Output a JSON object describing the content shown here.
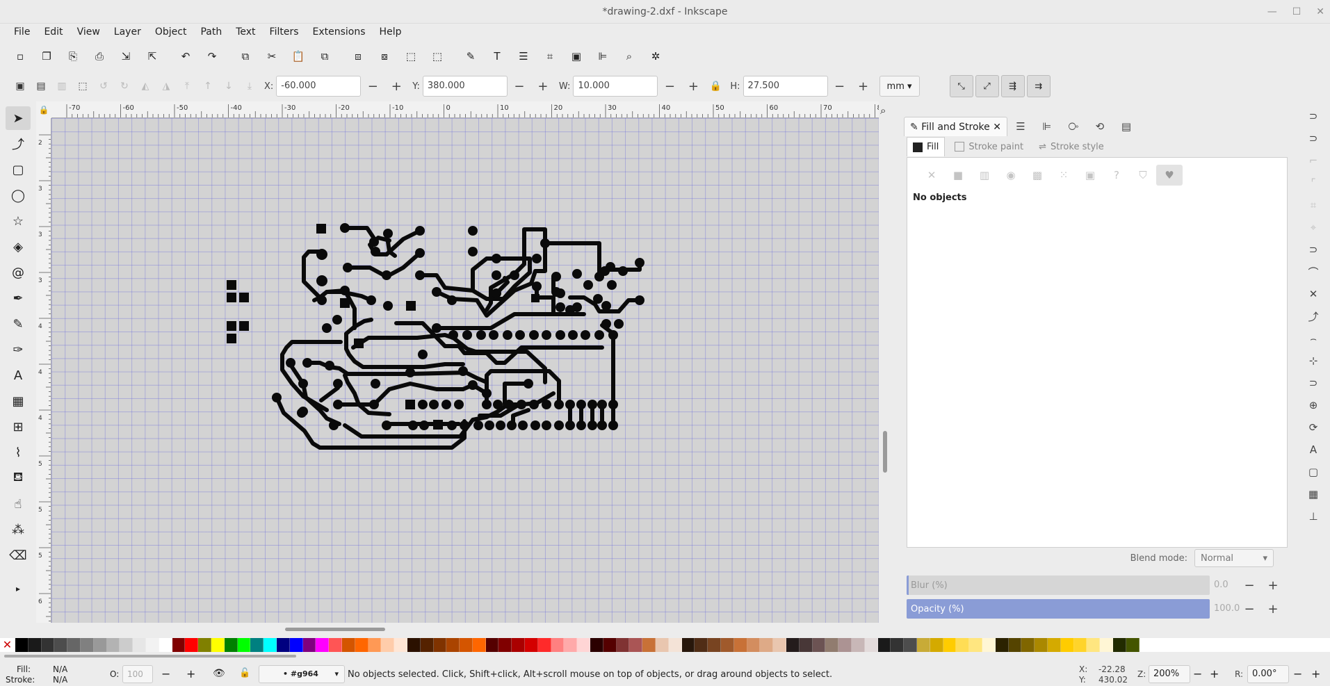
{
  "window": {
    "title": "*drawing-2.dxf - Inkscape",
    "controls": [
      "—",
      "☐",
      "✕"
    ]
  },
  "menu": [
    "File",
    "Edit",
    "View",
    "Layer",
    "Object",
    "Path",
    "Text",
    "Filters",
    "Extensions",
    "Help"
  ],
  "commands": [
    {
      "name": "new-document-icon",
      "g": "▫"
    },
    {
      "name": "open-document-icon",
      "g": "❐"
    },
    {
      "name": "save-document-icon",
      "g": "⎘"
    },
    {
      "name": "print-icon",
      "g": "⎙"
    },
    {
      "name": "import-icon",
      "g": "⇲"
    },
    {
      "name": "export-icon",
      "g": "⇱"
    },
    {
      "name": "undo-icon",
      "g": "↶"
    },
    {
      "name": "redo-icon",
      "g": "↷"
    },
    {
      "name": "copy-icon",
      "g": "⧉"
    },
    {
      "name": "cut-icon",
      "g": "✂"
    },
    {
      "name": "paste-icon",
      "g": "📋"
    },
    {
      "name": "duplicate-icon",
      "g": "⧉"
    },
    {
      "name": "clone-icon",
      "g": "⧈"
    },
    {
      "name": "unlink-clone-icon",
      "g": "⧇"
    },
    {
      "name": "group-icon",
      "g": "⬚"
    },
    {
      "name": "ungroup-icon",
      "g": "⬚"
    },
    {
      "name": "fill-stroke-dialog-icon",
      "g": "✎"
    },
    {
      "name": "text-font-dialog-icon",
      "g": "T"
    },
    {
      "name": "layers-dialog-icon",
      "g": "☰"
    },
    {
      "name": "xml-editor-icon",
      "g": "⌗"
    },
    {
      "name": "document-properties-icon",
      "g": "▣"
    },
    {
      "name": "align-dialog-icon",
      "g": "⊫"
    },
    {
      "name": "find-icon",
      "g": "⌕"
    },
    {
      "name": "preferences-icon",
      "g": "✲"
    }
  ],
  "controls": {
    "x": {
      "label": "X:",
      "value": "-60.000"
    },
    "y": {
      "label": "Y:",
      "value": "380.000"
    },
    "w": {
      "label": "W:",
      "value": "10.000"
    },
    "h": {
      "label": "H:",
      "value": "27.500"
    },
    "unit": "mm"
  },
  "ruler": {
    "h_labels": [
      "-70",
      "-60",
      "-50",
      "-40",
      "-30",
      "-20",
      "-10",
      "0",
      "10",
      "20",
      "30",
      "40",
      "50",
      "60",
      "70",
      "80"
    ],
    "v_labels": [
      "2",
      "3",
      "3",
      "3",
      "4",
      "4",
      "4",
      "5",
      "5",
      "5",
      "6"
    ]
  },
  "dock": {
    "tab_title": "Fill and Stroke",
    "subtabs": {
      "fill": "Fill",
      "stroke_paint": "Stroke paint",
      "stroke_style": "Stroke style"
    },
    "no_objects": "No objects",
    "blend_label": "Blend mode:",
    "blend_value": "Normal",
    "blur": {
      "label": "Blur (%)",
      "value": "0.0",
      "level": 0.008
    },
    "opacity": {
      "label": "Opacity (%)",
      "value": "100.0",
      "level": 1.0
    }
  },
  "palette": [
    "#000000",
    "#1a1a1a",
    "#333333",
    "#4d4d4d",
    "#666666",
    "#808080",
    "#999999",
    "#b3b3b3",
    "#cccccc",
    "#e6e6e6",
    "#f2f2f2",
    "#ffffff",
    "#800000",
    "#ff0000",
    "#808000",
    "#ffff00",
    "#008000",
    "#00ff00",
    "#008080",
    "#00ffff",
    "#000080",
    "#0000ff",
    "#800080",
    "#ff00ff",
    "#ff5555",
    "#d45500",
    "#ff6600",
    "#ff9955",
    "#ffccaa",
    "#ffe6d5",
    "#2b1100",
    "#552200",
    "#803300",
    "#aa4400",
    "#d45500",
    "#ff6600",
    "#550000",
    "#800000",
    "#aa0000",
    "#d40000",
    "#ff2a2a",
    "#ff8080",
    "#ffaaaa",
    "#ffd5d5",
    "#2b0000",
    "#550000",
    "#803333",
    "#aa5555",
    "#c87137",
    "#e9c6af",
    "#f4e3d7",
    "#28170b",
    "#502d16",
    "#784421",
    "#a05a2c",
    "#c87137",
    "#d38d5f",
    "#deaa87",
    "#e9c6af",
    "#241c1c",
    "#483737",
    "#6c5353",
    "#917c6f",
    "#ac9393",
    "#c8b7b7",
    "#e3dbdb",
    "#1a1a1a",
    "#333333",
    "#4d4d4d",
    "#c8ab37",
    "#d4aa00",
    "#ffcc00",
    "#ffdd55",
    "#ffe680",
    "#fff6d5",
    "#2b2200",
    "#554400",
    "#806600",
    "#aa8800",
    "#d4aa00",
    "#ffcc00",
    "#ffd42a",
    "#ffe680",
    "#fff6d5",
    "#222b00",
    "#445500"
  ],
  "status": {
    "fill_label": "Fill:",
    "fill_value": "N/A",
    "stroke_label": "Stroke:",
    "stroke_value": "N/A",
    "opacity_label": "O:",
    "opacity_value": "100",
    "layer": "• #g964",
    "message": "No objects selected. Click, Shift+click, Alt+scroll mouse on top of objects, or drag around objects to select.",
    "cursor_x_label": "X:",
    "cursor_x": "-22.28",
    "cursor_y_label": "Y:",
    "cursor_y": "430.02",
    "zoom_label": "Z:",
    "zoom": "200%",
    "rotate_label": "R:",
    "rotate": "0.00°"
  }
}
